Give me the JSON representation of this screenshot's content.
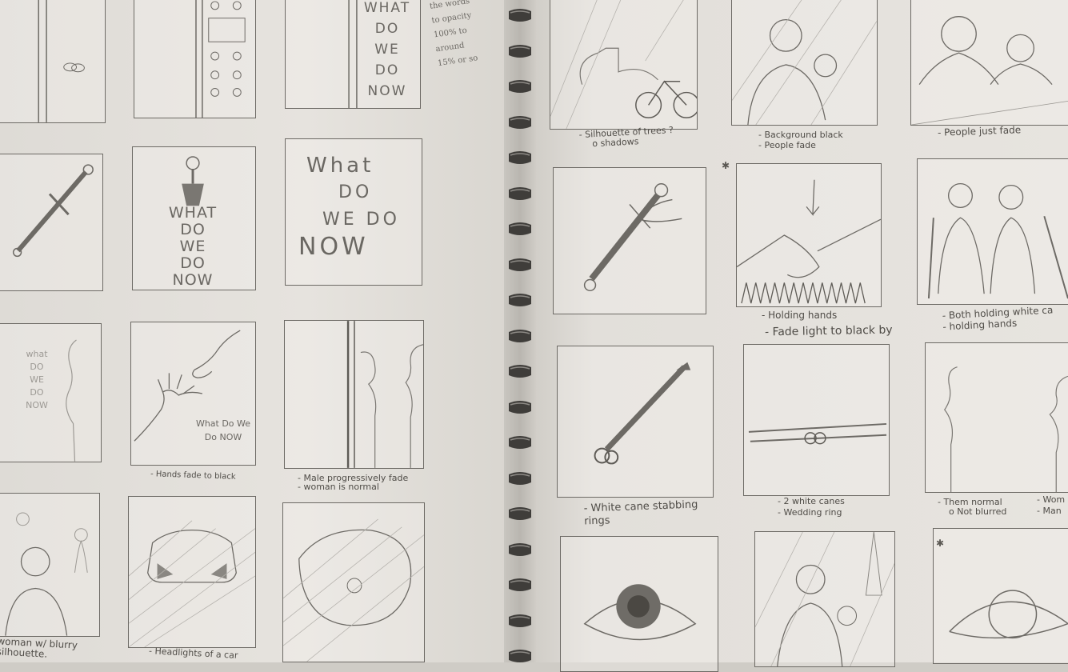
{
  "sketchbook": {
    "side_note": {
      "lines": [
        "the words",
        "to opacity",
        "100% to",
        "around",
        "15% or so"
      ]
    },
    "frame_text": {
      "elevator_words": [
        "WHAT",
        "DO",
        "WE",
        "DO",
        "NOW"
      ],
      "title_words_lines": [
        "What",
        "DO",
        "WE DO",
        "NOW"
      ],
      "dagger_words": [
        "WHAT",
        "DO",
        "WE",
        "DO",
        "NOW"
      ],
      "faded_words": [
        "what",
        "DO",
        "WE",
        "DO",
        "NOW"
      ],
      "hands_words": [
        "What Do We",
        "Do NOW"
      ]
    },
    "captions": {
      "hands_fade": "- Hands fade to black",
      "male_fade_1": "- Male progressively fade",
      "male_fade_2": "- woman is normal",
      "woman_blurry_1": "woman w/ blurry",
      "woman_blurry_2": "silhouette.",
      "headlights": "- Headlights of a car",
      "trees_1": "- Silhouette of trees ?",
      "trees_2": "o shadows",
      "background_black_1": "- Background black",
      "background_black_2": "- People fade",
      "people_fade": "- People just fade",
      "holding_hands": "- Holding hands",
      "fade_light": "- Fade light to black by",
      "both_holding_1": "- Both holding white ca",
      "both_holding_2": "- holding hands",
      "white_cane_1": "- White cane stabbing",
      "white_cane_2": "rings",
      "two_canes_1": "- 2 white canes",
      "two_canes_2": "- Wedding ring",
      "them_normal_1": "- Them normal",
      "them_normal_2": "o Not blurred",
      "wom": "- Wom",
      "man": "- Man"
    }
  }
}
